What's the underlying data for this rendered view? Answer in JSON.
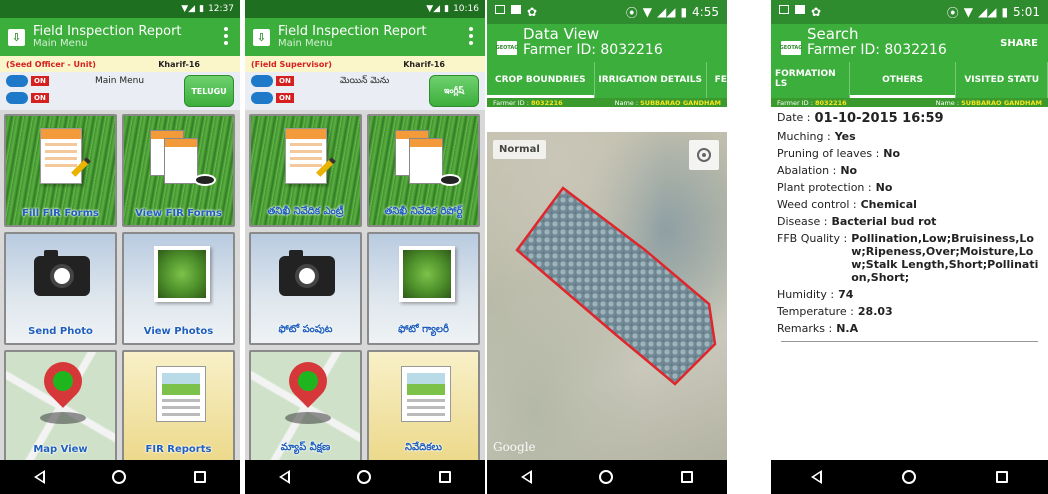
{
  "screen1": {
    "status_time": "12:37",
    "app_title": "Field Inspection Report",
    "app_subtitle": "Main Menu",
    "role": "(Seed Officer - Unit)",
    "season": "Kharif-16",
    "main_menu_label": "Main Menu",
    "toggle1": "ON",
    "toggle2": "ON",
    "language_button": "TELUGU",
    "tiles": [
      "Fill FIR Forms",
      "View FIR Forms",
      "Send Photo",
      "View Photos",
      "Map View",
      "FIR Reports"
    ]
  },
  "screen2": {
    "status_time": "10:16",
    "app_title": "Field Inspection Report",
    "app_subtitle": "Main Menu",
    "role": "(Field Supervisor)",
    "season": "Kharif-16",
    "main_menu_label": "మెయిన్ మెను",
    "toggle1": "ON",
    "toggle2": "ON",
    "language_button": "ఇంగ్లీష్",
    "tiles": [
      "తనిఖీ నివేదిక ఎంట్రీ",
      "తనిఖీ నివేదిక రిపోర్ట్",
      "ఫోటో పంపుట",
      "ఫోటో గ్యాలరీ",
      "మ్యాప్ వీక్షణ",
      "నివేదికలు"
    ]
  },
  "screen3": {
    "status_time": "4:55",
    "title": "Data View",
    "farmer_line": "Farmer ID: 8032216",
    "logo": "GEOTAG",
    "tabs": [
      "CROP BOUNDRIES",
      "IRRIGATION DETAILS",
      "FERTILIZER"
    ],
    "farmer_id_label": "Farmer ID :",
    "farmer_id_value": "8032216",
    "name_label": "Name :",
    "name_value": "SUBBARAO GANDHAM",
    "map_type_button": "Normal",
    "map_watermark": "Google"
  },
  "screen4": {
    "status_time": "5:01",
    "title": "Search",
    "farmer_line": "Farmer ID: 8032216",
    "logo": "GEOTAG",
    "share_label": "SHARE",
    "tabs": [
      "FORMATION LS",
      "OTHERS",
      "VISITED STATU"
    ],
    "farmer_id_label": "Farmer ID :",
    "farmer_id_value": "8032216",
    "name_label": "Name :",
    "name_value": "SUBBARAO GANDHAM",
    "fields": [
      {
        "key": "Date :",
        "value": "01-10-2015 16:59"
      },
      {
        "key": "Muching :",
        "value": "Yes"
      },
      {
        "key": "Pruning of leaves :",
        "value": "No"
      },
      {
        "key": "Abalation :",
        "value": "No"
      },
      {
        "key": "Plant protection :",
        "value": "No"
      },
      {
        "key": "Weed control :",
        "value": "Chemical"
      },
      {
        "key": "Disease :",
        "value": "Bacterial bud rot"
      },
      {
        "key": "FFB Quality :",
        "value": "Pollination,Low;Bruisiness,Low;Ripeness,Over;Moisture,Low;Stalk Length,Short;Pollination,Short;"
      },
      {
        "key": "Humidity :",
        "value": "74"
      },
      {
        "key": "Temperature :",
        "value": "28.03"
      },
      {
        "key": "Remarks :",
        "value": "N.A"
      }
    ]
  },
  "colors": {
    "app_green": "#3cae3c",
    "status_green": "#1e6f1f",
    "label_blue": "#1f5fbf",
    "boundary_red": "#e0262a"
  }
}
